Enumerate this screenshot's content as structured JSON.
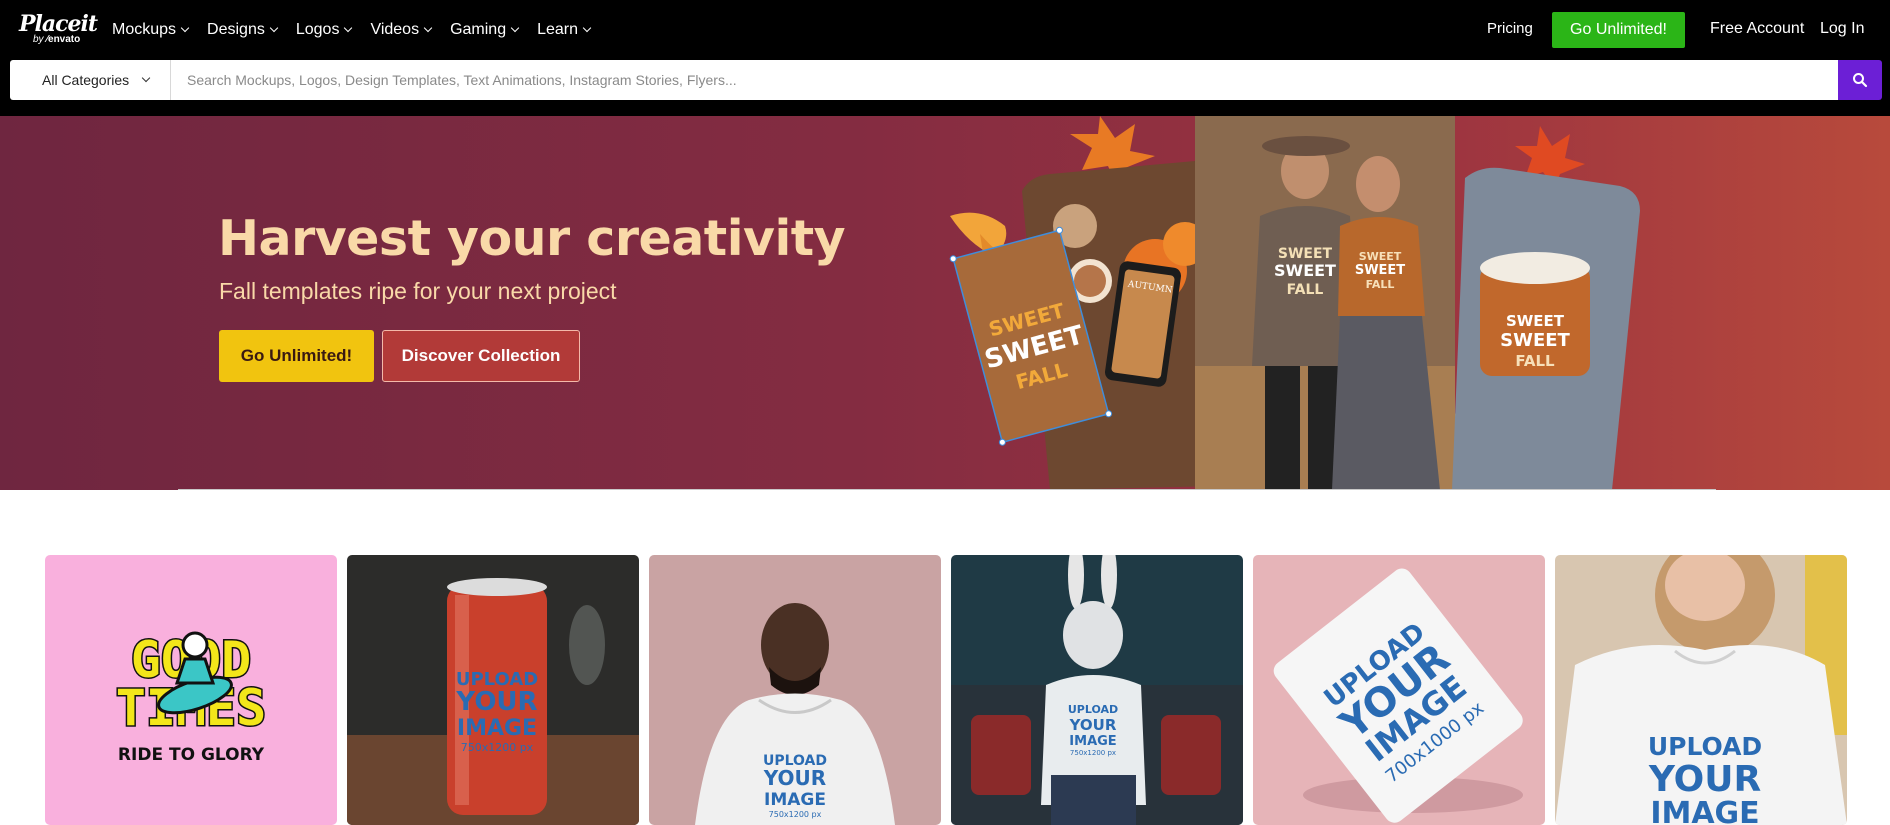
{
  "nav": {
    "logo": "Placeit",
    "logo_by": "by",
    "logo_brand": "envato",
    "items": [
      {
        "label": "Mockups"
      },
      {
        "label": "Designs"
      },
      {
        "label": "Logos"
      },
      {
        "label": "Videos"
      },
      {
        "label": "Gaming"
      },
      {
        "label": "Learn"
      }
    ],
    "pricing": "Pricing",
    "go_unlimited": "Go Unlimited!",
    "free_account": "Free Account",
    "log_in": "Log In"
  },
  "search": {
    "category": "All Categories",
    "placeholder": "Search Mockups, Logos, Design Templates, Text Animations, Instagram Stories, Flyers...",
    "button_icon": "search-icon"
  },
  "hero": {
    "title": "Harvest your creativity",
    "subtitle": "Fall templates ripe for your next project",
    "primary_button": "Go Unlimited!",
    "secondary_button": "Discover Collection",
    "art": {
      "card_line1": "SWEET",
      "card_line2": "SWEET",
      "card_line3": "FALL",
      "phone_text": "AUTUMN"
    }
  },
  "tiles": [
    {
      "type": "logo-design",
      "line1": "GOOD",
      "line2": "TIMES",
      "line3": "RIDE TO GLORY"
    },
    {
      "type": "can-mockup",
      "line1": "UPLOAD",
      "line2": "YOUR",
      "line3": "IMAGE",
      "size": "750x1200 px"
    },
    {
      "type": "hoodie-mockup",
      "line1": "UPLOAD",
      "line2": "YOUR",
      "line3": "IMAGE",
      "size": "750x1200 px"
    },
    {
      "type": "sweatshirt-mockup",
      "line1": "UPLOAD",
      "line2": "YOUR",
      "line3": "IMAGE",
      "size": "750x1200 px"
    },
    {
      "type": "pouch-mockup",
      "line1": "UPLOAD",
      "line2": "YOUR",
      "line3": "IMAGE",
      "size": "700x1000 px"
    },
    {
      "type": "tshirt-mockup",
      "line1": "UPLOAD",
      "line2": "YOUR",
      "line3": "IMAGE"
    }
  ],
  "colors": {
    "nav_bg": "#000000",
    "accent_green": "#2bb517",
    "search_button": "#6c1fd6",
    "hero_title": "#f9d9a8",
    "hero_primary": "#f1c40f",
    "hero_secondary": "#b23a38"
  }
}
